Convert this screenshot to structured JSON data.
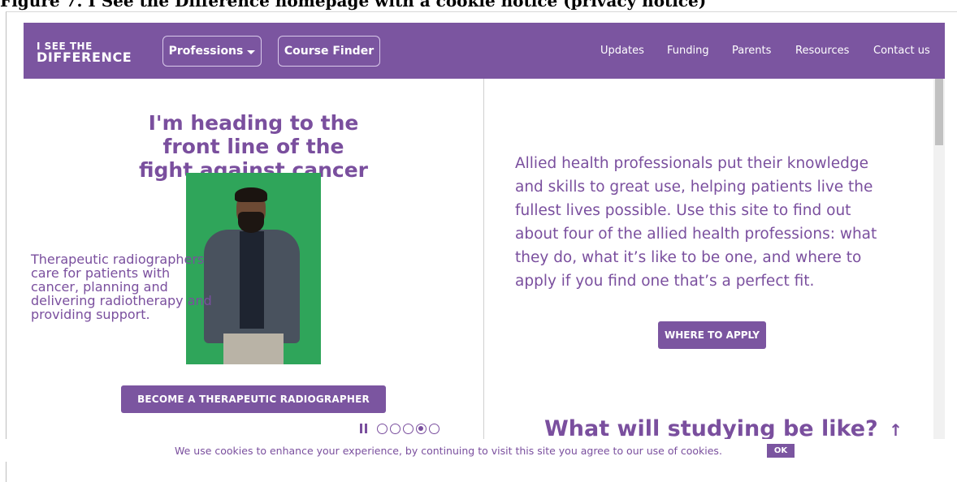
{
  "doc_caption": "Figure 7. I See the Difference homepage with a cookie notice (privacy notice)",
  "header": {
    "logo_line1": "I SEE THE",
    "logo_line2": "DIFFERENCE",
    "professions_label": "Professions",
    "course_finder_label": "Course Finder",
    "links": [
      "Updates",
      "Funding",
      "Parents",
      "Resources",
      "Contact us"
    ]
  },
  "hero": {
    "title_lines": [
      "I'm heading to the",
      "front line of the",
      "fight against cancer"
    ],
    "description": "Therapeutic radiographers care for patients with cancer, planning and delivering radiotherapy and providing support.",
    "cta_label": "BECOME A THERAPEUTIC RADIOGRAPHER",
    "carousel": {
      "slides": 5,
      "active_index": 3
    }
  },
  "intro": {
    "text": "Allied health professionals put their knowledge and skills to great use, helping patients live the fullest lives possible. Use this site to find out about four of the allied health professions: what they do, what it’s like to be one, and where to apply if you find one that’s a perfect fit.",
    "cta_label": "WHERE TO APPLY"
  },
  "study": {
    "heading": "What will studying be like?",
    "arrow": "↑"
  },
  "cookie": {
    "text": "We use cookies to enhance your experience, by continuing to visit this site you agree to our use of cookies.",
    "ok_label": "OK"
  },
  "colors": {
    "brand_purple": "#7b55a0",
    "text_purple": "#7a4f9e",
    "photo_green": "#2fa55a"
  },
  "icons": {
    "professions_dropdown": "chevron-down-icon",
    "pause": "pause-icon",
    "scroll_top": "arrow-up-icon"
  }
}
